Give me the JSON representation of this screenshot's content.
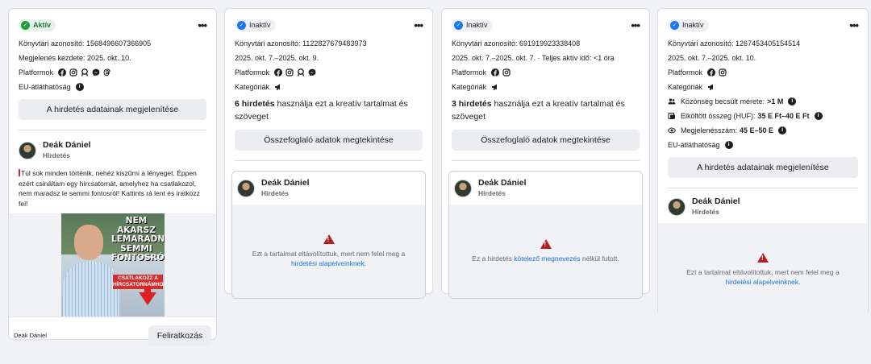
{
  "cards": [
    {
      "status": "Aktív",
      "library_id": "Könyvtári azonosító: 1568496607366905",
      "started": "Megjelenés kezdete: 2025. okt. 10.",
      "platforms_label": "Platformok",
      "transparency": "EU-átláthatóság",
      "details_button": "A hirdetés adatainak megjelenítése",
      "advertiser": "Deák Dániel",
      "sponsored": "Hirdetés",
      "ad_text": "Túl sok minden történik, nehéz kiszűrni a lényeget. Éppen ezért csináltam egy hírcsatornát, amelyhez ha csatlakozol, nem maradsz le semmi fontosról! Kattints rá lent és iratkozz fel!",
      "creative_headline": "NEM AKARSZ LEMARADNI SEMMI FONTOSRÓL?",
      "creative_cta": "CSATLAKOZZ A HÍRCSATORNÁMHOZ!",
      "footer_name": "Deák Dániel",
      "subscribe_button": "Feliratkozás"
    },
    {
      "status": "Inaktív",
      "library_id": "Könyvtári azonosító: 1122827679483973",
      "dates": "2025. okt. 7.–2025. okt. 9.",
      "platforms_label": "Platformok",
      "categories_label": "Kategóriák",
      "usage_bold": "6 hirdetés",
      "usage_rest": " használja ezt a kreatív tartalmat és szöveget",
      "summary_button": "Összefoglaló adatok megtekintése",
      "advertiser": "Deák Dániel",
      "sponsored": "Hirdetés",
      "removed_text": "Ezt a tartalmat eltávolítottuk, mert nem felel meg a ",
      "removed_link": "hirdetési alapelveinknek",
      "removed_end": "."
    },
    {
      "status": "Inaktív",
      "library_id": "Könyvtári azonosító: 691919923338408",
      "dates": "2025. okt. 7.–2025. okt. 7. · Teljes aktív idő: <1 óra",
      "platforms_label": "Platformok",
      "categories_label": "Kategóriák",
      "usage_bold": "3 hirdetés",
      "usage_rest": " használja ezt a kreatív tartalmat és szöveget",
      "summary_button": "Összefoglaló adatok megtekintése",
      "advertiser": "Deák Dániel",
      "sponsored": "Hirdetés",
      "removed_text": "Ez a hirdetés ",
      "removed_link": "kötelező megnevezés",
      "removed_end": " nélkül futott."
    },
    {
      "status": "Inaktív",
      "library_id": "Könyvtári azonosító: 1267453405154514",
      "dates": "2025. okt. 7.–2025. okt. 10.",
      "platforms_label": "Platformok",
      "categories_label": "Kategóriák",
      "audience_label": "Közönség becsült mérete: ",
      "audience_value": ">1 M",
      "spend_label": "Elköltött összeg (HUF): ",
      "spend_value": "35 E Ft–40 E Ft",
      "impressions_label": "Megjelenésszám: ",
      "impressions_value": "45 E–50 E",
      "transparency": "EU-átláthatóság",
      "details_button": "A hirdetés adatainak megjelenítése",
      "advertiser": "Deák Dániel",
      "sponsored": "Hirdetés",
      "removed_text": "Ezt a tartalmat eltávolítottuk, mert nem felel meg a ",
      "removed_link": "hirdetési alapelveinknek",
      "removed_end": "."
    }
  ],
  "more_label": "•••",
  "info_glyph": "i",
  "colors": {
    "active_green": "#1e9e40",
    "inactive_blue": "#1877f2",
    "link": "#216fdb",
    "warning": "#b71c1c"
  }
}
